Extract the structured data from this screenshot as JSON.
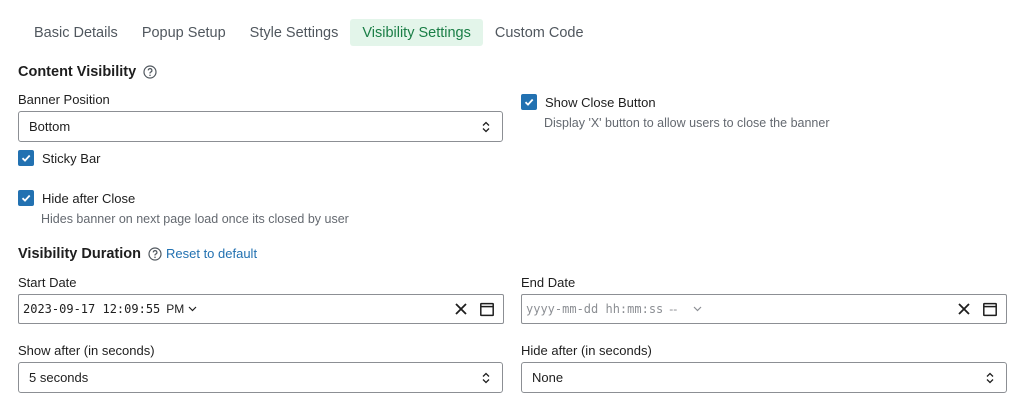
{
  "tabs": [
    {
      "label": "Basic Details"
    },
    {
      "label": "Popup Setup"
    },
    {
      "label": "Style Settings"
    },
    {
      "label": "Visibility Settings"
    },
    {
      "label": "Custom Code"
    }
  ],
  "active_tab": "Visibility Settings",
  "content_visibility": {
    "title": "Content Visibility",
    "banner_position": {
      "label": "Banner Position",
      "value": "Bottom"
    },
    "sticky_bar": {
      "label": "Sticky Bar",
      "checked": true
    },
    "hide_after_close": {
      "label": "Hide after Close",
      "checked": true,
      "help": "Hides banner on next page load once its closed by user"
    },
    "show_close_button": {
      "label": "Show Close Button",
      "checked": true,
      "help": "Display 'X' button to allow users to close the banner"
    }
  },
  "visibility_duration": {
    "title": "Visibility Duration",
    "reset_label": "Reset to default",
    "start_date": {
      "label": "Start Date",
      "value": "2023-09-17 12:09:55",
      "ampm": "PM"
    },
    "end_date": {
      "label": "End Date",
      "placeholder": "yyyy-mm-dd hh:mm:ss",
      "ampm": "--"
    },
    "show_after": {
      "label": "Show after (in seconds)",
      "value": "5 seconds"
    },
    "hide_after": {
      "label": "Hide after (in seconds)",
      "value": "None"
    }
  },
  "colors": {
    "accent": "#2271b1",
    "active_tab_bg": "#e3f5ea",
    "active_tab_text": "#1a7e46"
  }
}
